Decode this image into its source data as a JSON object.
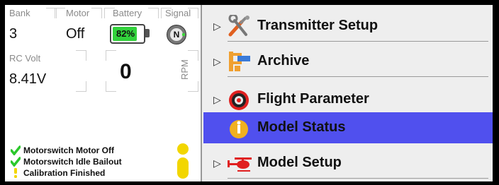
{
  "telemetry": {
    "bank": {
      "label": "Bank",
      "value": "3"
    },
    "motor": {
      "label": "Motor",
      "value": "Off"
    },
    "battery": {
      "label": "Battery",
      "percent_text": "82%",
      "level": 0.82
    },
    "signal": {
      "label": "Signal",
      "value": "N"
    },
    "rc_volt": {
      "label": "RC Volt",
      "value": "8.41V"
    },
    "rpm": {
      "value": "0",
      "unit": "RPM"
    }
  },
  "alerts": [
    {
      "text": "Motorswitch Motor Off",
      "icon": "check-icon"
    },
    {
      "text": "Motorswitch Idle Bailout",
      "icon": "check-icon"
    },
    {
      "text": "Calibration Finished",
      "icon": "exclamation-icon"
    }
  ],
  "menu": [
    {
      "label": "Transmitter Setup",
      "icon": "tools-icon",
      "selected": false
    },
    {
      "label": "Archive",
      "icon": "archive-icon",
      "selected": false
    },
    {
      "label": "Flight Parameter",
      "icon": "target-icon",
      "selected": false
    },
    {
      "label": "Model Status",
      "icon": "info-icon",
      "selected": true
    },
    {
      "label": "Model Setup",
      "icon": "helicopter-icon",
      "selected": false
    }
  ],
  "colors": {
    "selection": "#5050ee",
    "battery_fill": "#32d23c",
    "alert_green": "#2cc82c",
    "alert_yellow": "#f2d600"
  }
}
